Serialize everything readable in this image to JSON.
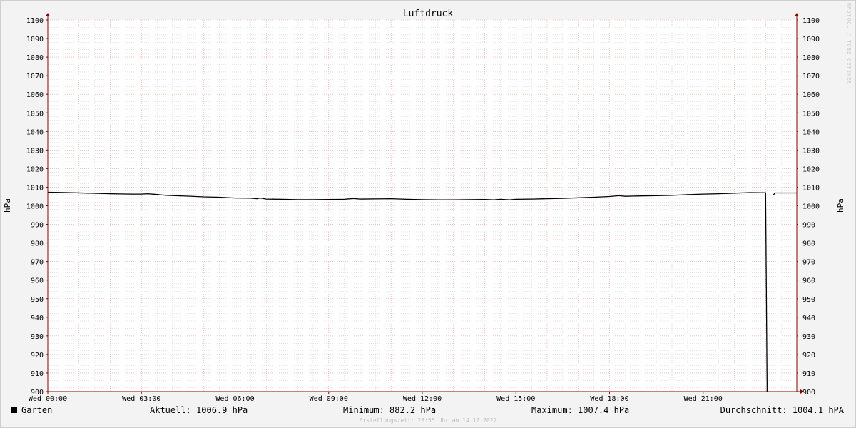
{
  "chart_data": {
    "type": "line",
    "title": "Luftdruck",
    "ylabel": "hPa",
    "ylim": [
      900,
      1100
    ],
    "y_ticks": [
      900,
      910,
      920,
      930,
      940,
      950,
      960,
      970,
      980,
      990,
      1000,
      1010,
      1020,
      1030,
      1040,
      1050,
      1060,
      1070,
      1080,
      1090,
      1100
    ],
    "xlim_hours": [
      0,
      24
    ],
    "x_ticks": [
      {
        "hour": 0,
        "label": "Wed 00:00"
      },
      {
        "hour": 3,
        "label": "Wed 03:00"
      },
      {
        "hour": 6,
        "label": "Wed 06:00"
      },
      {
        "hour": 9,
        "label": "Wed 09:00"
      },
      {
        "hour": 12,
        "label": "Wed 12:00"
      },
      {
        "hour": 15,
        "label": "Wed 15:00"
      },
      {
        "hour": 18,
        "label": "Wed 18:00"
      },
      {
        "hour": 21,
        "label": "Wed 21:00"
      }
    ],
    "grid": true,
    "series": [
      {
        "name": "Garten",
        "color": "#000000",
        "points": [
          [
            0.0,
            1007.3
          ],
          [
            0.25,
            1007.2
          ],
          [
            0.9,
            1007.0
          ],
          [
            1.3,
            1006.8
          ],
          [
            2.0,
            1006.5
          ],
          [
            2.7,
            1006.3
          ],
          [
            3.0,
            1006.3
          ],
          [
            3.2,
            1006.5
          ],
          [
            3.4,
            1006.2
          ],
          [
            3.8,
            1005.6
          ],
          [
            4.5,
            1005.2
          ],
          [
            5.0,
            1004.8
          ],
          [
            5.5,
            1004.6
          ],
          [
            6.0,
            1004.2
          ],
          [
            6.5,
            1004.1
          ],
          [
            6.7,
            1003.8
          ],
          [
            6.8,
            1004.2
          ],
          [
            7.0,
            1003.6
          ],
          [
            7.5,
            1003.5
          ],
          [
            8.0,
            1003.3
          ],
          [
            8.5,
            1003.3
          ],
          [
            9.0,
            1003.4
          ],
          [
            9.5,
            1003.5
          ],
          [
            9.8,
            1003.9
          ],
          [
            10.0,
            1003.6
          ],
          [
            10.5,
            1003.7
          ],
          [
            11.0,
            1003.8
          ],
          [
            11.5,
            1003.5
          ],
          [
            12.0,
            1003.3
          ],
          [
            12.5,
            1003.2
          ],
          [
            13.0,
            1003.2
          ],
          [
            13.5,
            1003.3
          ],
          [
            14.0,
            1003.4
          ],
          [
            14.3,
            1003.2
          ],
          [
            14.5,
            1003.5
          ],
          [
            14.8,
            1003.2
          ],
          [
            15.0,
            1003.5
          ],
          [
            15.5,
            1003.6
          ],
          [
            16.0,
            1003.8
          ],
          [
            16.5,
            1004.0
          ],
          [
            17.0,
            1004.3
          ],
          [
            17.5,
            1004.6
          ],
          [
            18.0,
            1005.0
          ],
          [
            18.3,
            1005.4
          ],
          [
            18.5,
            1005.1
          ],
          [
            19.0,
            1005.3
          ],
          [
            19.5,
            1005.4
          ],
          [
            20.0,
            1005.6
          ],
          [
            20.5,
            1006.0
          ],
          [
            21.0,
            1006.3
          ],
          [
            21.5,
            1006.5
          ],
          [
            22.0,
            1006.8
          ],
          [
            22.5,
            1007.1
          ],
          [
            23.0,
            1007.0
          ],
          [
            23.05,
            882.2
          ],
          null,
          [
            23.25,
            1005.8
          ],
          [
            23.3,
            1006.9
          ],
          [
            24.0,
            1006.9
          ]
        ]
      }
    ]
  },
  "legend": {
    "series_name": "Garten",
    "swatch_color": "#000000",
    "current": "Aktuell: 1006.9 hPa",
    "minimum": "Minimum: 882.2 hPa",
    "maximum": "Maximum: 1007.4 hPa",
    "average": "Durchschnitt: 1004.1 hPA"
  },
  "footer": "Erstellungszeit: 23:55 Uhr am 14.12.2022",
  "watermark": "RRDTOOL / TOBI OETIKER",
  "colors": {
    "background": "#f3f3f3",
    "plot_background": "#ffffff",
    "major_grid": "#e8a0a0",
    "minor_grid": "#cccccc",
    "axis": "#8b0000"
  }
}
